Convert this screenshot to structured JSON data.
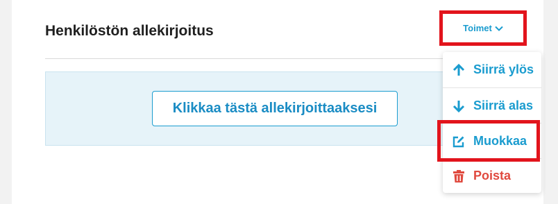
{
  "section": {
    "title": "Henkilöstön allekirjoitus",
    "actions_label": "Toimet"
  },
  "sign": {
    "button_label": "Klikkaa tästä allekirjoittaaksesi"
  },
  "menu": {
    "items": [
      {
        "label": "Siirrä ylös",
        "icon": "arrow-up-icon"
      },
      {
        "label": "Siirrä alas",
        "icon": "arrow-down-icon"
      },
      {
        "label": "Muokkaa",
        "icon": "edit-icon"
      },
      {
        "label": "Poista",
        "icon": "trash-icon"
      }
    ]
  },
  "colors": {
    "accent": "#1a9ccf",
    "danger": "#e04a3f",
    "highlight": "#e2141c",
    "sign_area_bg": "#e6f3f9"
  }
}
